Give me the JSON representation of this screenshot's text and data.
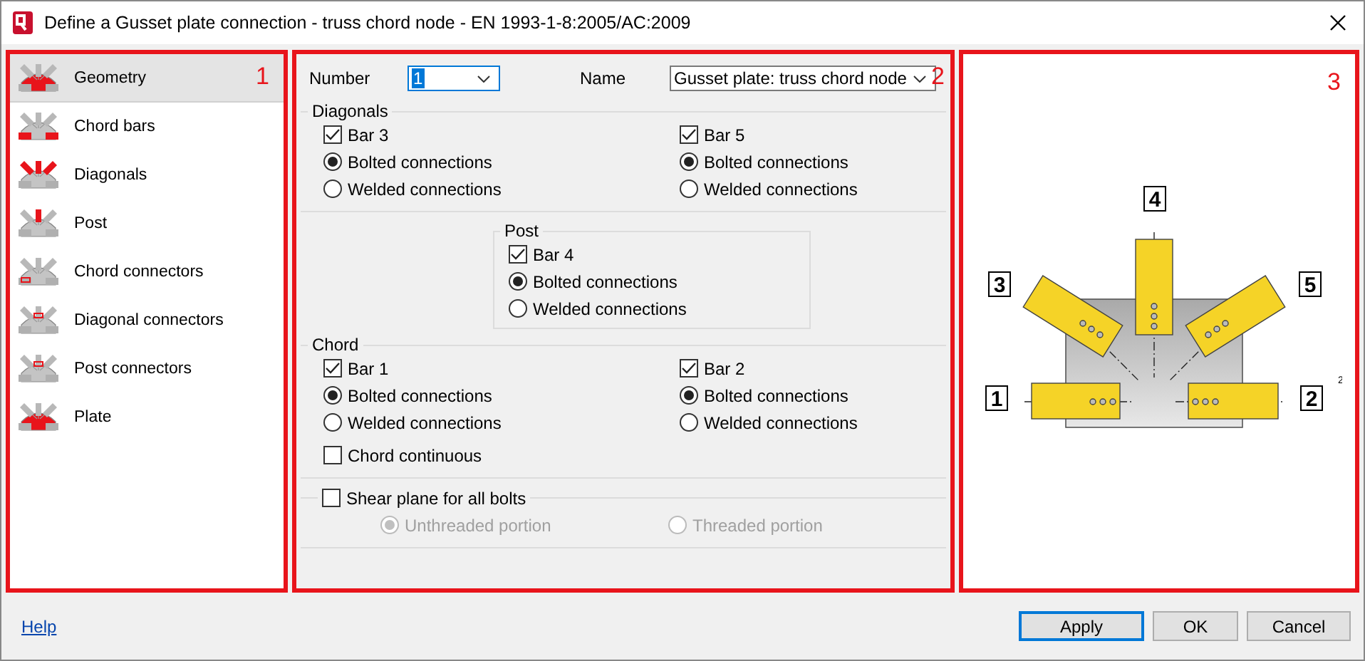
{
  "window": {
    "title": "Define a Gusset plate connection - truss chord node - EN 1993-1-8:2005/AC:2009"
  },
  "sidebar": {
    "marker": "1",
    "items": [
      {
        "label": "Geometry",
        "selected": true
      },
      {
        "label": "Chord bars",
        "selected": false
      },
      {
        "label": "Diagonals",
        "selected": false
      },
      {
        "label": "Post",
        "selected": false
      },
      {
        "label": "Chord connectors",
        "selected": false
      },
      {
        "label": "Diagonal connectors",
        "selected": false
      },
      {
        "label": "Post connectors",
        "selected": false
      },
      {
        "label": "Plate",
        "selected": false
      }
    ]
  },
  "form": {
    "marker": "2",
    "number": {
      "label": "Number",
      "value": "1"
    },
    "name": {
      "label": "Name",
      "value": "Gusset plate: truss chord node"
    },
    "groups": [
      {
        "title": "Diagonals",
        "kind": "wide",
        "bars": [
          {
            "label": "Bar 3",
            "checked": true,
            "options": [
              {
                "label": "Bolted connections",
                "selected": true
              },
              {
                "label": "Welded connections",
                "selected": false
              }
            ]
          },
          {
            "label": "Bar 5",
            "checked": true,
            "options": [
              {
                "label": "Bolted connections",
                "selected": true
              },
              {
                "label": "Welded connections",
                "selected": false
              }
            ]
          }
        ]
      },
      {
        "title": "Post",
        "kind": "box",
        "bars": [
          {
            "label": "Bar 4",
            "checked": true,
            "options": [
              {
                "label": "Bolted connections",
                "selected": true
              },
              {
                "label": "Welded connections",
                "selected": false
              }
            ]
          }
        ]
      },
      {
        "title": "Chord",
        "kind": "wide",
        "bars": [
          {
            "label": "Bar 1",
            "checked": true,
            "options": [
              {
                "label": "Bolted connections",
                "selected": true
              },
              {
                "label": "Welded connections",
                "selected": false
              }
            ]
          },
          {
            "label": "Bar 2",
            "checked": true,
            "options": [
              {
                "label": "Bolted connections",
                "selected": true
              },
              {
                "label": "Welded connections",
                "selected": false
              }
            ]
          }
        ],
        "extra": {
          "label": "Chord continuous",
          "checked": false
        }
      }
    ],
    "shear": {
      "label": "Shear plane for all bolts",
      "checked": false,
      "options": [
        {
          "label": "Unthreaded portion",
          "selected": true,
          "disabled": true
        },
        {
          "label": "Threaded portion",
          "selected": false,
          "disabled": true
        }
      ]
    }
  },
  "preview": {
    "marker": "3",
    "bar_labels": [
      "1",
      "2",
      "3",
      "4",
      "5"
    ],
    "note": "2"
  },
  "footer": {
    "help": "Help",
    "buttons": [
      {
        "label": "Apply",
        "default": true
      },
      {
        "label": "OK",
        "default": false
      },
      {
        "label": "Cancel",
        "default": false
      }
    ]
  }
}
